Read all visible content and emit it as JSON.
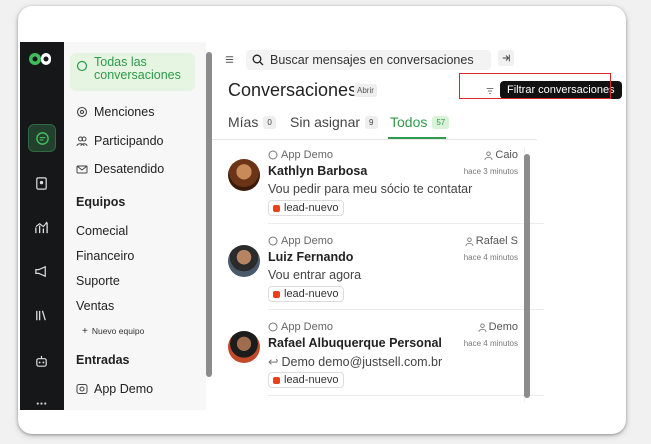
{
  "search": {
    "placeholder": "Buscar mensajes en conversaciones"
  },
  "nav": {
    "items": [
      {
        "label": "Todas las conversaciones"
      },
      {
        "label": "Menciones"
      },
      {
        "label": "Participando"
      },
      {
        "label": "Desatendido"
      }
    ],
    "teams_header": "Equipos",
    "teams": [
      "Comecial",
      "Financeiro",
      "Suporte",
      "Ventas"
    ],
    "new_team": "Nuevo equipo",
    "inbox_header": "Entradas",
    "inboxes": [
      "App Demo"
    ]
  },
  "page": {
    "title": "Conversaciones",
    "status_badge": "Abrir",
    "filter_tooltip": "Filtrar conversaciones"
  },
  "tabs": [
    {
      "label": "Mías",
      "count": "0"
    },
    {
      "label": "Sin asignar",
      "count": "9"
    },
    {
      "label": "Todos",
      "count": "57"
    }
  ],
  "conversations": [
    {
      "inbox": "App Demo",
      "assignee": "Caio",
      "name": "Kathlyn Barbosa",
      "time": "hace 3 minutos",
      "message": "Vou pedir para meu sócio te contatar",
      "tag": "lead-nuevo"
    },
    {
      "inbox": "App Demo",
      "assignee": "Rafael S",
      "name": "Luiz Fernando",
      "time": "hace 4 minutos",
      "message": "Vou entrar agora",
      "tag": "lead-nuevo"
    },
    {
      "inbox": "App Demo",
      "assignee": "Demo",
      "name": "Rafael Albuquerque Personal",
      "time": "hace 4 minutos",
      "message": "Demo demo@justsell.com.br",
      "tag": "lead-nuevo"
    }
  ],
  "colors": {
    "accent": "#2f9a49",
    "rail": "#151718",
    "tag_dot": "#e8411c",
    "highlight": "#d8282b"
  },
  "icons": [
    "logo-icon",
    "chat-icon",
    "contacts-icon",
    "reports-icon",
    "campaigns-icon",
    "library-icon",
    "bot-icon",
    "search-icon",
    "filter-icon",
    "collapse-icon",
    "menu-icon"
  ]
}
